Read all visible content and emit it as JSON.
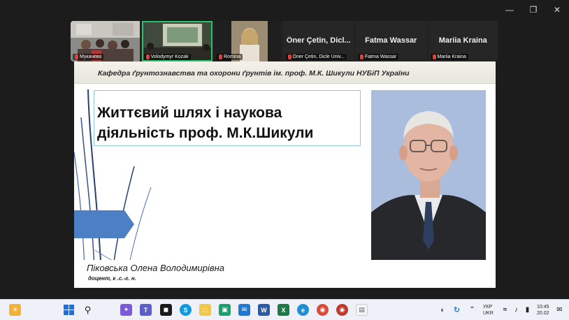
{
  "participants": [
    {
      "name": "Мукачево",
      "kind": "video"
    },
    {
      "name": "Volodymyr Kozak",
      "kind": "video",
      "active": true
    },
    {
      "name": "Romina",
      "kind": "video"
    },
    {
      "name": "Öner Çetin, Dicle Univ...",
      "display_name": "Öner Çetin,  Dicl...",
      "kind": "name"
    },
    {
      "name": "Fatma Wassar",
      "display_name": "Fatma Wassar",
      "kind": "name"
    },
    {
      "name": "Mariia Kraina",
      "display_name": "Mariia Kraina",
      "kind": "name"
    }
  ],
  "slide": {
    "header": "Кафедра ґрунтознавства та охорони ґрунтів ім. проф. М.К. Шикули НУБіП України",
    "title_line1": "Життєвий шлях і наукова",
    "title_line2": "діяльність проф. М.К.Шикули",
    "author_name": "Піковська Олена Володимирівна",
    "author_title": "доцент, к .с.-г. н."
  },
  "tray": {
    "lang_top": "УКР",
    "lang_bottom": "UKR",
    "time": "10:45",
    "date": "20.02"
  },
  "colors": {
    "active_speaker": "#27c26b",
    "slide_title_border": "#8ccbd8",
    "slide_arrow": "#4d7fc4",
    "taskbar": "#eef1f7"
  }
}
